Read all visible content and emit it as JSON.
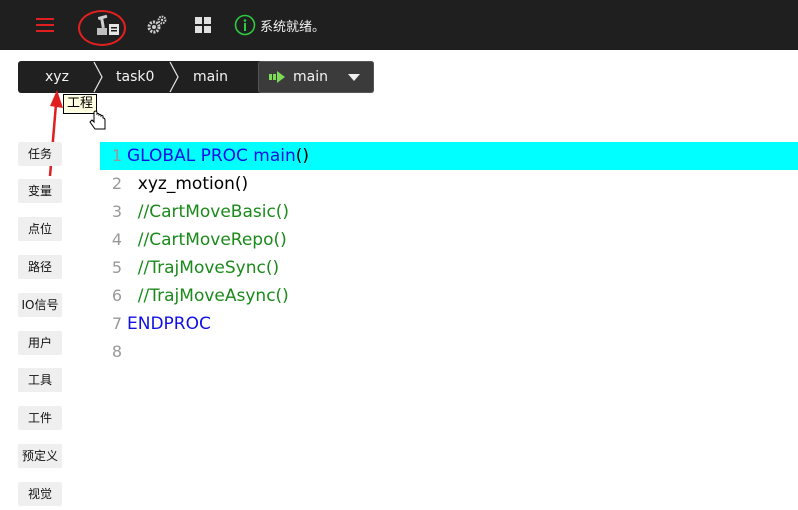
{
  "topbar": {
    "status_text": "系统就绪。",
    "icons": [
      "menu-icon",
      "robot-icon",
      "gear-icon",
      "grid-icon",
      "info-icon"
    ],
    "colors": {
      "background": "#1f1f1f",
      "menu": "#e02020",
      "status": "#2ecc40"
    }
  },
  "breadcrumb": {
    "project": "xyz",
    "task": "task0",
    "program": "main",
    "function": "main"
  },
  "tooltip": {
    "text": "工程"
  },
  "sidebar": {
    "items": [
      {
        "label": "任务"
      },
      {
        "label": "变量"
      },
      {
        "label": "点位"
      },
      {
        "label": "路径"
      },
      {
        "label": "IO信号"
      },
      {
        "label": "用户"
      },
      {
        "label": "工具"
      },
      {
        "label": "工件"
      },
      {
        "label": "预定义"
      },
      {
        "label": "视觉"
      }
    ]
  },
  "editor": {
    "active_line": 1,
    "lines": [
      {
        "no": "1",
        "kw": "GLOBAL PROC main",
        "plain": "()",
        "comment": ""
      },
      {
        "no": "2",
        "kw": "",
        "plain": "  xyz_motion()",
        "comment": ""
      },
      {
        "no": "3",
        "kw": "",
        "plain": "",
        "comment": "  //CartMoveBasic()"
      },
      {
        "no": "4",
        "kw": "",
        "plain": "",
        "comment": "  //CartMoveRepo()"
      },
      {
        "no": "5",
        "kw": "",
        "plain": "",
        "comment": "  //TrajMoveSync()"
      },
      {
        "no": "6",
        "kw": "",
        "plain": "",
        "comment": "  //TrajMoveAsync()"
      },
      {
        "no": "7",
        "kw": "ENDPROC",
        "plain": "",
        "comment": ""
      },
      {
        "no": "8",
        "kw": "",
        "plain": "",
        "comment": ""
      }
    ]
  }
}
